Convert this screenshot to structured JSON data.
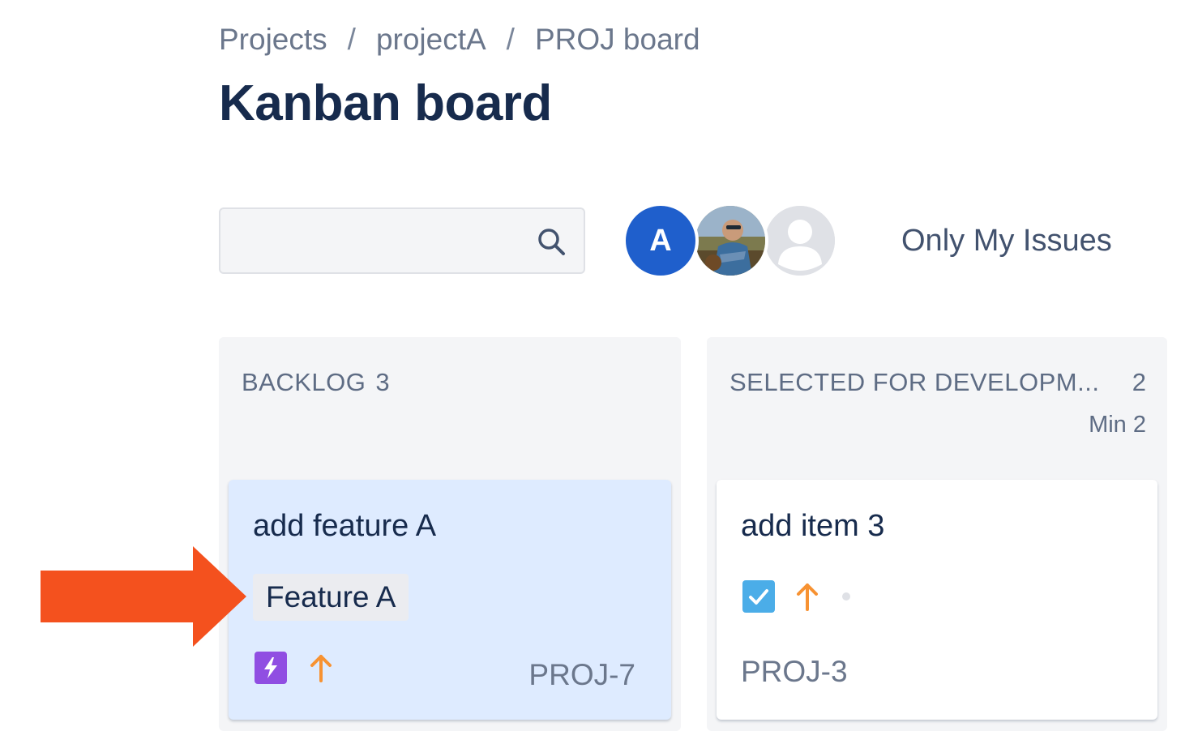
{
  "breadcrumb": {
    "items": [
      "Projects",
      "projectA",
      "PROJ board"
    ],
    "separator": "/"
  },
  "page": {
    "title": "Kanban board"
  },
  "search": {
    "value": "",
    "placeholder": ""
  },
  "avatars": [
    {
      "initial": "A",
      "color": "#1f5fcc"
    },
    {
      "type": "photo"
    },
    {
      "type": "default"
    }
  ],
  "filters": {
    "only_my_issues": "Only My Issues"
  },
  "columns": [
    {
      "name": "BACKLOG",
      "count": "3",
      "cards": [
        {
          "title": "add feature A",
          "epic": "Feature A",
          "type_icon": "story-lightning-icon",
          "priority_icon": "priority-high-arrow-icon",
          "key": "PROJ-7"
        }
      ]
    },
    {
      "name": "SELECTED FOR DEVELOPM...",
      "count": "2",
      "min": "Min 2",
      "cards": [
        {
          "title": "add item 3",
          "type_icon": "task-checkbox-icon",
          "priority_icon": "priority-high-arrow-icon",
          "key": "PROJ-3"
        }
      ]
    }
  ],
  "colors": {
    "title": "#172b4d",
    "muted": "#6b778c",
    "selected_card_bg": "#deebff",
    "column_bg": "#f4f5f7",
    "annotation_arrow": "#f4511e",
    "priority": "#f79232",
    "story_icon": "#904ee2",
    "task_icon": "#4bade8"
  },
  "annotation": {
    "arrow_icon": "annotation-arrow-icon"
  }
}
